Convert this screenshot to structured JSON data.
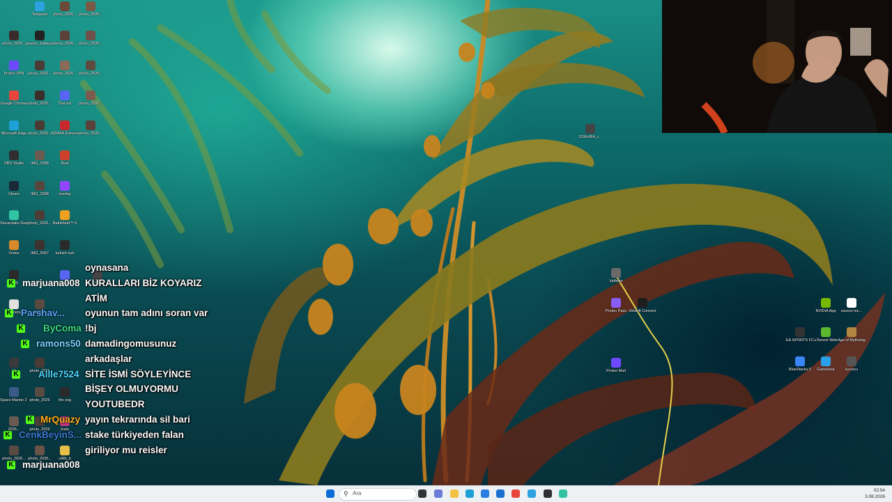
{
  "desktop_icons": [
    {
      "label": "Telegram",
      "color": "#2aa3e0"
    },
    {
      "label": "photo_2026...",
      "color": "#6b4a3a"
    },
    {
      "label": "photo_2026...",
      "color": "#7a5a44"
    },
    {
      "label": "photo_2026...",
      "color": "#3a2c2a"
    },
    {
      "label": "pixelsn_battleye",
      "color": "#222222"
    },
    {
      "label": "photo_2026...",
      "color": "#5d4038"
    },
    {
      "label": "photo_2026...",
      "color": "#6e5048"
    },
    {
      "label": "Proton VPN",
      "color": "#6d4aff"
    },
    {
      "label": "photo_2026...",
      "color": "#4b3a36"
    },
    {
      "label": "photo_2026...",
      "color": "#8a6a58"
    },
    {
      "label": "photo_2026...",
      "color": "#5f4a40"
    },
    {
      "label": "Google Chrome",
      "color": "#e8453c"
    },
    {
      "label": "photo_2026...",
      "color": "#3c2e2b"
    },
    {
      "label": "Discord",
      "color": "#5865f2"
    },
    {
      "label": "photo_2026...",
      "color": "#7b5b4b"
    },
    {
      "label": "Microsoft Edge",
      "color": "#1fa0d8"
    },
    {
      "label": "photo_2026...",
      "color": "#4a3a34"
    },
    {
      "label": "AIDA64 Extreme",
      "color": "#c8282c"
    },
    {
      "label": "photo_2026...",
      "color": "#5a423a"
    },
    {
      "label": "OBS Studio",
      "color": "#302e31"
    },
    {
      "label": "IMG_2588",
      "color": "#6b5a4f"
    },
    {
      "label": "Rust",
      "color": "#cd412b"
    },
    {
      "label": "Steam",
      "color": "#1b2838"
    },
    {
      "label": "IMG_2588",
      "color": "#57473f"
    },
    {
      "label": "overlay",
      "color": "#9146ff"
    },
    {
      "label": "Streamlabs Desktop",
      "color": "#31c3a2"
    },
    {
      "label": "photo_2026...",
      "color": "#4e3d37"
    },
    {
      "label": "Battlefield™ 6",
      "color": "#f0a020"
    },
    {
      "label": "Vortex",
      "color": "#d88a2a"
    },
    {
      "label": "IMG_5067",
      "color": "#3f322e"
    },
    {
      "label": "turkish turk",
      "color": "#2a2a2a"
    },
    {
      "label": "OBS",
      "color": "#2a2a2a"
    },
    {
      "label": "Discord",
      "color": "#5865f2"
    },
    {
      "label": "Vega",
      "color": "#444444"
    },
    {
      "label": "harmony",
      "color": "#e0e0e0"
    },
    {
      "label": "IMG...",
      "color": "#5a4a40"
    },
    {
      "label": "lyl",
      "color": "#3a3a3a"
    },
    {
      "label": "photo_2026",
      "color": "#4a3a34"
    },
    {
      "label": "Space Marine 2 [TL]",
      "color": "#3a5a8a"
    },
    {
      "label": "photo_2026",
      "color": "#5a4a44"
    },
    {
      "label": "the sog",
      "color": "#2a2a2a"
    },
    {
      "label": "2026...",
      "color": "#6a5a50"
    },
    {
      "label": "photo_2026",
      "color": "#4a3c36"
    },
    {
      "label": "insta",
      "color": "#c13584"
    },
    {
      "label": "photo_2026...",
      "color": "#5b4a42"
    },
    {
      "label": "photo_2026...",
      "color": "#6a5448"
    },
    {
      "label": "utilib_b",
      "color": "#e8c048"
    },
    {
      "label": "1536x864_c...",
      "color": "#444444"
    },
    {
      "label": "Valheim",
      "color": "#6a6a6a"
    },
    {
      "label": "Proton Pass",
      "color": "#8a5cf6"
    },
    {
      "label": "Ubisoft Connect",
      "color": "#1e1e1e"
    },
    {
      "label": "Proton Mail",
      "color": "#6d4aff"
    },
    {
      "label": "NVIDIA App",
      "color": "#76b900"
    },
    {
      "label": "source-rec...",
      "color": "#ffffff"
    },
    {
      "label": "EA SPORTS FC™ 26",
      "color": "#333333"
    },
    {
      "label": "uTorrent Web",
      "color": "#5cb82e"
    },
    {
      "label": "Age of Mythology",
      "color": "#b48840"
    },
    {
      "label": "BlueStacks 5",
      "color": "#3b86f7"
    },
    {
      "label": "Gameloop",
      "color": "#2aa0e8"
    },
    {
      "label": "lucescu",
      "color": "#555555"
    }
  ],
  "chat": [
    {
      "user": "",
      "user_color": "#ffffff",
      "badge": false,
      "message": "oynasana"
    },
    {
      "user": "marjuana008",
      "user_color": "#ffffff",
      "badge": true,
      "message": "KURALLARI BİZ KOYARIZ"
    },
    {
      "user": "",
      "user_color": "#ffffff",
      "badge": false,
      "message": "ATİM"
    },
    {
      "user": "Parshav...",
      "user_color": "#5aa6ff",
      "badge": true,
      "message": "oyunun tam adını soran var"
    },
    {
      "user": "ByComa",
      "user_color": "#3ddc84",
      "badge": true,
      "message": "!bj"
    },
    {
      "user": "ramons50",
      "user_color": "#7ad3ff",
      "badge": true,
      "message": "damadingomusunuz"
    },
    {
      "user": "",
      "user_color": "#ffffff",
      "badge": false,
      "message": "arkadaşlar"
    },
    {
      "user": "Allle7524",
      "user_color": "#4fd6ff",
      "badge": true,
      "message": "SİTE İSMİ SÖYLEYİNCE"
    },
    {
      "user": "",
      "user_color": "#ffffff",
      "badge": false,
      "message": "BİŞEY OLMUYORMU"
    },
    {
      "user": "",
      "user_color": "#ffffff",
      "badge": false,
      "message": "YOUTUBEDR"
    },
    {
      "user": "MrQuazy",
      "user_color": "#ffb020",
      "badge": true,
      "message": "yayın tekrarında sil bari"
    },
    {
      "user": "CenkBeyinS...",
      "user_color": "#3a7bd5",
      "badge": true,
      "message": "stake türkiyeden falan"
    },
    {
      "user": "",
      "user_color": "#ffffff",
      "badge": false,
      "message": "giriliyor mu reisler"
    },
    {
      "user": "marjuana008",
      "user_color": "#ffffff",
      "badge": true,
      "message": ""
    }
  ],
  "taskbar": {
    "search_placeholder": "Ara",
    "time": "02:54",
    "date": "3.08.2026",
    "icons": [
      {
        "name": "start-icon",
        "color": "#0a6cd6"
      },
      {
        "name": "task-view-icon",
        "color": "#333333"
      },
      {
        "name": "copilot-icon",
        "color": "#6a7bd8"
      },
      {
        "name": "file-explorer-icon",
        "color": "#f5c242"
      },
      {
        "name": "edge-icon",
        "color": "#1fa0d8"
      },
      {
        "name": "ms-store-icon",
        "color": "#2a7de1"
      },
      {
        "name": "mail-icon",
        "color": "#1a6fd0"
      },
      {
        "name": "chrome-icon",
        "color": "#e8453c"
      },
      {
        "name": "telegram-icon",
        "color": "#2aa3e0"
      },
      {
        "name": "obs-icon",
        "color": "#302e31"
      },
      {
        "name": "streamlabs-icon",
        "color": "#31c3a2"
      }
    ]
  }
}
